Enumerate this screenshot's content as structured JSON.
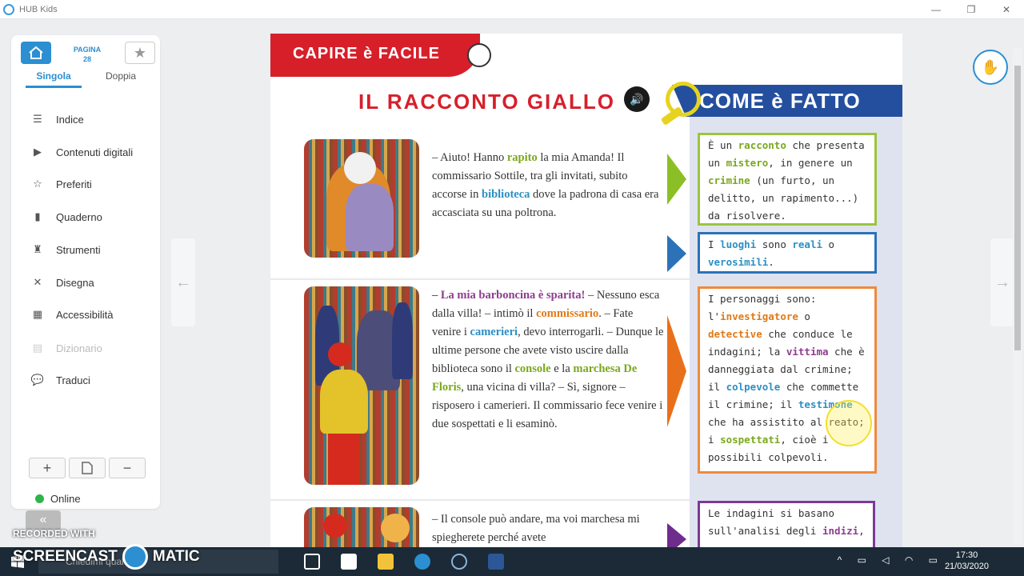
{
  "window": {
    "title": "HUB Kids",
    "controls": [
      "—",
      "❐",
      "✕"
    ]
  },
  "sidebar": {
    "page_label": "PAGINA",
    "page_number": "28",
    "tabs": [
      "Singola",
      "Doppia"
    ],
    "items": [
      {
        "label": "Indice",
        "icon": "list-icon"
      },
      {
        "label": "Contenuti digitali",
        "icon": "video-icon"
      },
      {
        "label": "Preferiti",
        "icon": "star-icon"
      },
      {
        "label": "Quaderno",
        "icon": "notebook-icon"
      },
      {
        "label": "Strumenti",
        "icon": "tools-icon"
      },
      {
        "label": "Disegna",
        "icon": "draw-icon"
      },
      {
        "label": "Accessibilità",
        "icon": "accessibility-icon"
      },
      {
        "label": "Dizionario",
        "icon": "dictionary-icon"
      },
      {
        "label": "Traduci",
        "icon": "translate-icon"
      }
    ],
    "zoom_buttons": [
      "+",
      "",
      "−"
    ],
    "status": "Online"
  },
  "page": {
    "banner": "CAPIRE è FACILE",
    "title": "IL RACCONTO GIALLO",
    "side_header": "COME è FATTO",
    "story1": {
      "p1": "– Aiuto! Hanno ",
      "k1": "rapito",
      "p2": " la mia Amanda! Il commissario Sottile, tra gli invitati, subito accorse in ",
      "k2": "biblioteca",
      "p3": " dove la padrona di casa era accasciata su una poltrona."
    },
    "story2": {
      "k1": "– La mia barboncina è sparita!",
      "p1": " – Nessuno esca dalla villa! – intimò il ",
      "k2": "commissario",
      "p2": ". – Fate venire i ",
      "k3": "camerieri",
      "p3": ", devo interrogarli. – Dunque le ultime persone che avete visto uscire dalla biblioteca sono il ",
      "k4": "console",
      "p4": " e la ",
      "k5": "marchesa De Floris",
      "p5": ", una vicina di villa? – Sì, signore – risposero i camerieri. Il commissario fece venire i due sospettati e li esaminò."
    },
    "story3": {
      "p1": "– Il console può andare, ma voi marchesa mi spiegherete perché avete"
    },
    "box1": {
      "p1": "È un ",
      "k1": "racconto",
      "p2": " che presenta un ",
      "k2": "mistero",
      "p3": ", in genere un ",
      "k3": "crimine",
      "p4": " (un furto, un delitto, un rapimento...) da risolvere."
    },
    "box2": {
      "p1": "I ",
      "k1": "luoghi",
      "p2": " sono ",
      "k2": "reali",
      "p3": " o ",
      "k3": "verosimili",
      "p4": "."
    },
    "box3": {
      "p1": "I personaggi sono: l'",
      "k1": "investigatore",
      "p2": " o ",
      "k2": "detective",
      "p3": " che conduce le indagini; la ",
      "k3": "vittima",
      "p4": " che è danneggiata dal crimine; il ",
      "k4": "colpevole",
      "p5": " che commette il crimine; il ",
      "k5": "testimone",
      "p6": " che ha assistito al reato; i ",
      "k6": "sospettati",
      "p7": ", cioè i possibili colpevoli."
    },
    "box4": {
      "p1": "Le indagini si basano sull'analisi degli ",
      "k1": "indizi",
      "p2": ","
    },
    "colors": {
      "red": "#d71f2a",
      "navy": "#244f9e",
      "green": "#7aa81c",
      "blue": "#2c8fc4",
      "orange": "#e07a17",
      "purple": "#8e3c8f"
    }
  },
  "taskbar": {
    "search_placeholder": "Chiedimi qualcosa",
    "time": "17:30",
    "date": "21/03/2020"
  },
  "watermark": {
    "line1": "RECORDED WITH",
    "line2a": "SCREENCAST",
    "line2b": "MATIC"
  }
}
